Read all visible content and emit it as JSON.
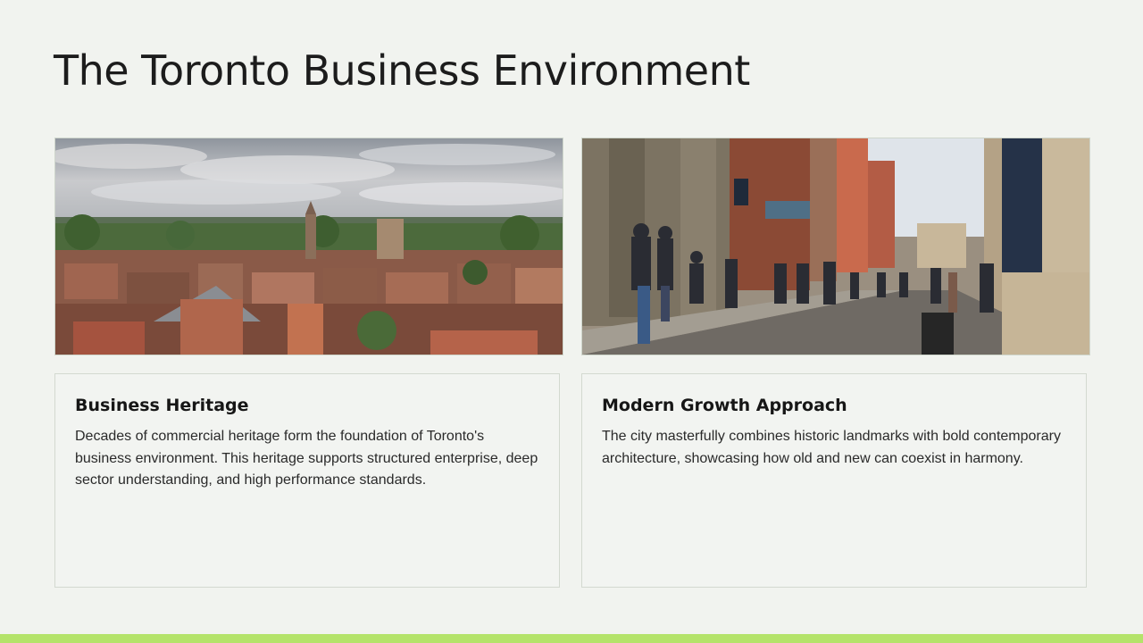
{
  "slide": {
    "title": "The Toronto Business Environment"
  },
  "images": {
    "left_icon": "city-skyline-photo",
    "right_icon": "street-scene-photo"
  },
  "cards": [
    {
      "heading": "Business Heritage",
      "body": "Decades of commercial heritage form the foundation of Toronto's business environment. This heritage supports structured enterprise, deep sector understanding, and high performance standards."
    },
    {
      "heading": "Modern Growth Approach",
      "body": "The city masterfully combines historic landmarks with bold contemporary architecture, showcasing how old and new can coexist in harmony."
    }
  ],
  "colors": {
    "background": "#f1f3ef",
    "accent": "#b4e36a",
    "card_border": "#d3d9d0"
  }
}
